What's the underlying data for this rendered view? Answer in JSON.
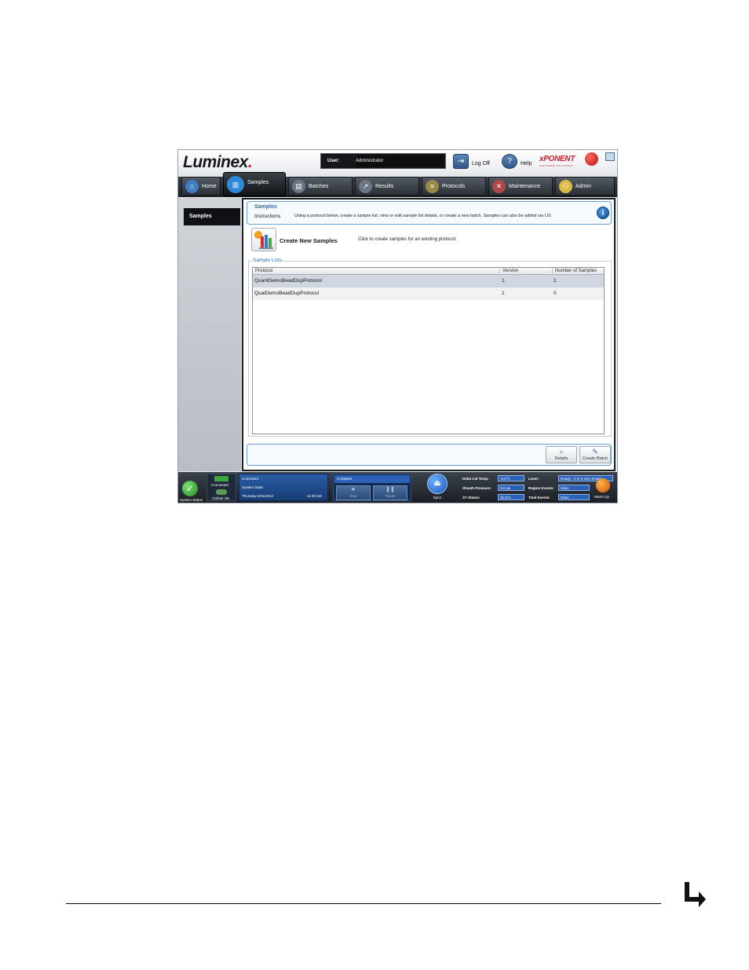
{
  "header": {
    "logo": "Luminex",
    "user_label": "User:",
    "user_value": "Administrator",
    "logoff_label": "Log Off",
    "help_label": "Help",
    "brand": "xPONENT",
    "brand_sub": "SOFTWARE SOLUTIONS"
  },
  "nav": {
    "tabs": [
      {
        "label": "Home",
        "icon": "home-icon"
      },
      {
        "label": "Samples",
        "icon": "samples-icon",
        "active": true
      },
      {
        "label": "Batches",
        "icon": "batches-icon"
      },
      {
        "label": "Results",
        "icon": "results-icon"
      },
      {
        "label": "Protocols",
        "icon": "protocols-icon"
      },
      {
        "label": "Maintenance",
        "icon": "maintenance-icon"
      },
      {
        "label": "Admin",
        "icon": "admin-icon"
      }
    ]
  },
  "sidebar": {
    "items": [
      {
        "label": "Samples"
      }
    ]
  },
  "instructions": {
    "title": "Samples",
    "subtitle": "Instructions",
    "text": "Using a protocol below, create a sample list; view or edit sample list details, or create a new batch. Samples can also be added via LIS"
  },
  "create": {
    "label": "Create New Samples",
    "description": "Click to create samples for an existing protocol."
  },
  "sample_lists": {
    "legend": "Sample Lists",
    "columns": [
      "Protocol",
      "Version",
      "Number of Samples"
    ],
    "rows": [
      {
        "protocol": "QuantDemoBeadDupProtocol",
        "version": "1",
        "samples": "1",
        "selected": true
      },
      {
        "protocol": "QualDemoBeadDupProtocol",
        "version": "1",
        "samples": "0",
        "selected": false
      }
    ]
  },
  "actions": {
    "details": "Details",
    "create_batch": "Create Batch"
  },
  "status": {
    "system_status": "System Status",
    "connected": "Connected",
    "calver": "Cal/Ver Ok",
    "command_label": "Command:",
    "system_state_label": "System State:",
    "date": "Thursday 5/31/2012",
    "time": "11:38 AM",
    "progress_label": "Complete",
    "stop": "Stop",
    "pause": "Pause",
    "eject": "Eject",
    "delta_cal_label": "Delta Cal Temp:",
    "delta_cal_value": "-0.0°C",
    "sheath_label": "Sheath Pressure:",
    "sheath_value": "9.5 psi",
    "xy_label": "XY Status:",
    "xy_value": "25.8°C",
    "laser_label": "Laser:",
    "laser_value": "Ready - 2 hr 9 min remain",
    "region_label": "Region Events:",
    "region_value": "0/sec",
    "total_label": "Total Events:",
    "total_value": "0/sec",
    "warmup": "Warm Up"
  },
  "colors": {
    "accent": "#2d6fb8",
    "nav_dark": "#1d2126",
    "brand_red": "#c81e2c"
  }
}
